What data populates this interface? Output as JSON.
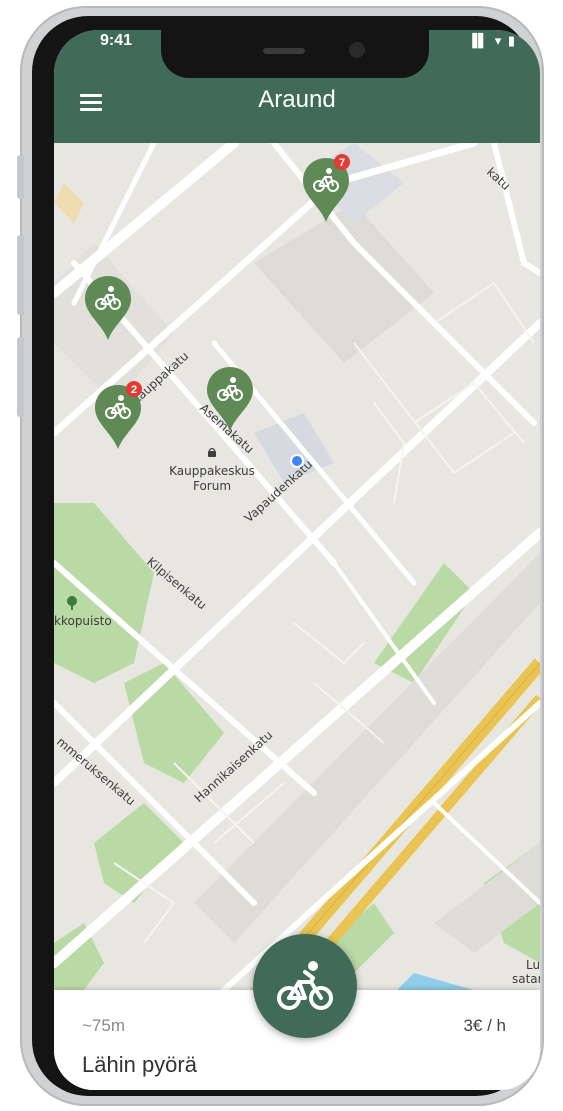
{
  "status_bar": {
    "time": "9:41",
    "signal": "▐▌ ▾ ▮"
  },
  "header": {
    "title": "Araund",
    "menu_icon": "hamburger-menu-icon"
  },
  "map": {
    "streets": [
      "Kauppakatu",
      "Asemakatu",
      "Vapaudenkatu",
      "Kilpisenkatu",
      "Hannikaisenkatu",
      "mmeruksenkatu",
      "katu"
    ],
    "pois": [
      {
        "name": "Kauppakeskus\nForum",
        "line1": "Kauppakeskus",
        "line2": "Forum"
      },
      {
        "name": "kkopuisto"
      },
      {
        "name": "Lu",
        "line2": "satar"
      }
    ],
    "bike_markers": [
      {
        "icon": "bicycle-icon",
        "badge": "7"
      },
      {
        "icon": "bicycle-icon",
        "badge": ""
      },
      {
        "icon": "bicycle-icon",
        "badge": "2"
      },
      {
        "icon": "bicycle-icon",
        "badge": ""
      }
    ]
  },
  "bottom_sheet": {
    "distance": "~75m",
    "price": "3€ / h",
    "title": "Lähin pyörä"
  },
  "colors": {
    "brand": "#3f6b58",
    "marker": "#5f8a55",
    "badge": "#e53935",
    "park": "#b9d9a5",
    "water": "#8fcdea",
    "highway": "#e9c452",
    "road": "#ffffff",
    "land": "#e8e6e1"
  }
}
